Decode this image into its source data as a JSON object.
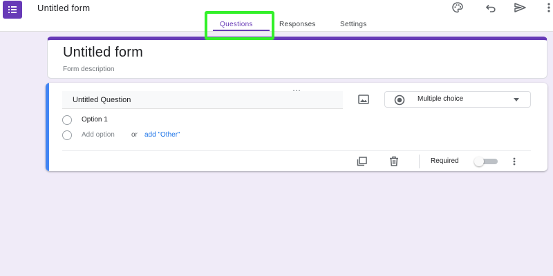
{
  "header": {
    "title": "Untitled form",
    "icons": [
      "palette-icon",
      "undo-icon",
      "send-icon",
      "more-vert-icon"
    ]
  },
  "tabs": [
    {
      "label": "Questions",
      "active": true
    },
    {
      "label": "Responses",
      "active": false
    },
    {
      "label": "Settings",
      "active": false
    }
  ],
  "form": {
    "title": "Untitled form",
    "description": "Form description"
  },
  "question": {
    "title": "Untitled Question",
    "type": "Multiple choice",
    "options": [
      {
        "label": "Option 1"
      }
    ],
    "add_option_label": "Add option",
    "or_label": "or",
    "add_other_label": "add \"Other\"",
    "required_label": "Required",
    "required": false
  },
  "colors": {
    "brand": "#673ab7",
    "accent": "#4285f4",
    "background": "#f0ebf8",
    "highlight": "#33f02a",
    "link": "#1a73e8"
  }
}
